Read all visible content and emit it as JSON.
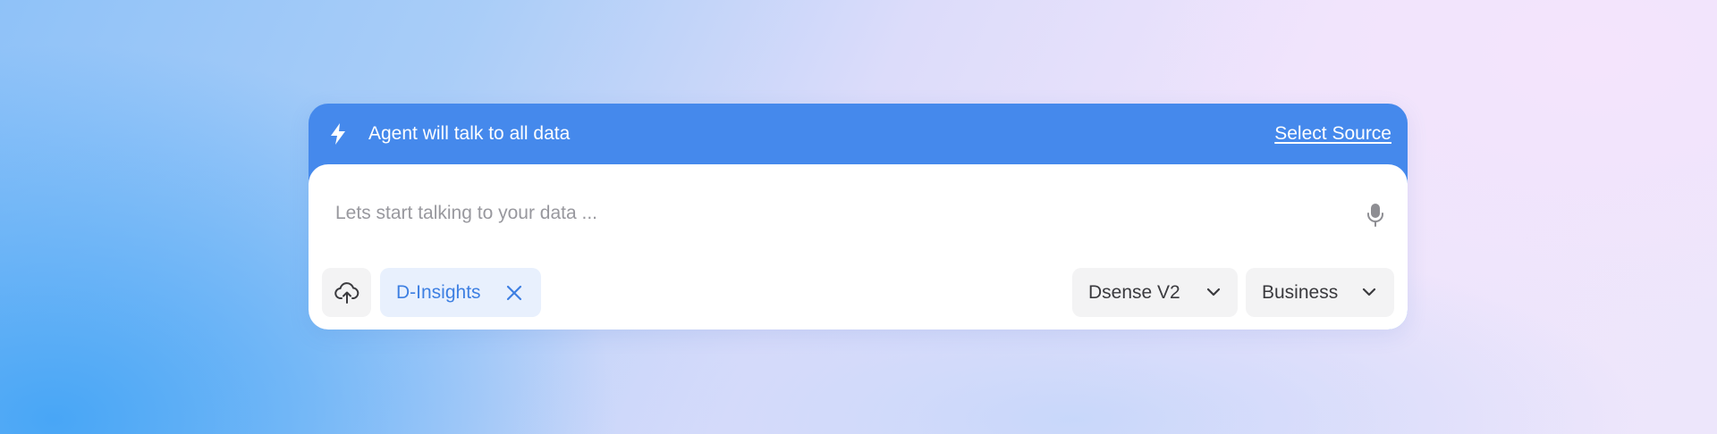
{
  "banner": {
    "message": "Agent will talk to all data",
    "select_source_label": "Select Source",
    "icon": "lightning-bolt-icon"
  },
  "composer": {
    "input_value": "",
    "input_placeholder": "Lets start talking to your data ...",
    "mic_icon": "microphone-icon",
    "upload_icon": "cloud-upload-icon"
  },
  "source_chip": {
    "label": "D-Insights",
    "remove_icon": "close-icon"
  },
  "model_select": {
    "selected": "Dsense V2",
    "icon": "chevron-down-icon"
  },
  "mode_select": {
    "selected": "Business",
    "icon": "chevron-down-icon"
  },
  "colors": {
    "banner_bg": "#4589ec",
    "chip_bg": "#e8f0fd",
    "chip_text": "#3d7fe2",
    "control_bg": "#f3f3f4",
    "placeholder": "#98989e"
  }
}
